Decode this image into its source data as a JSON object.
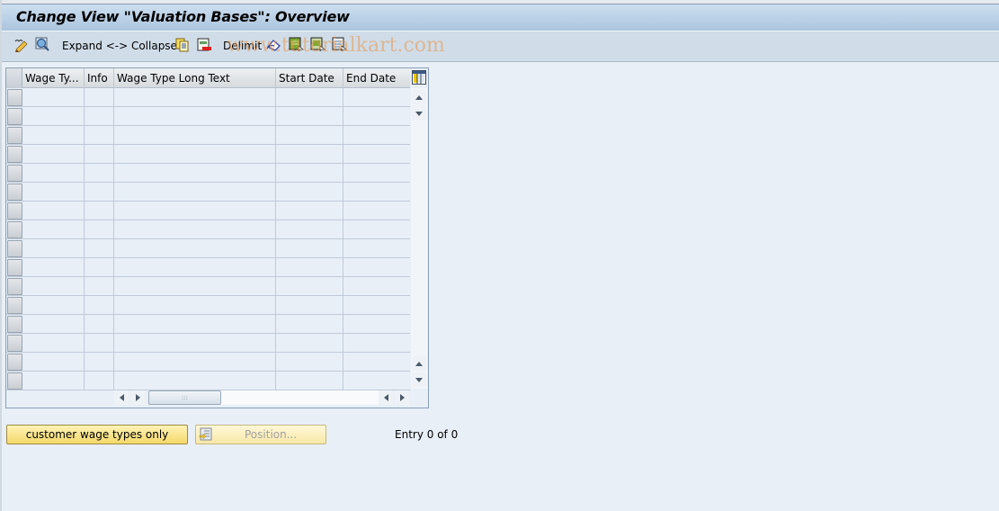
{
  "window": {
    "title": "Change View \"Valuation Bases\": Overview"
  },
  "toolbar": {
    "items": [
      {
        "name": "change-display-icon",
        "label": ""
      },
      {
        "name": "details-icon",
        "label": ""
      },
      {
        "name": "expand-collapse",
        "label": "Expand <-> Collapse"
      },
      {
        "name": "copy-icon",
        "label": ""
      },
      {
        "name": "delete-icon",
        "label": ""
      },
      {
        "name": "delimit",
        "label": "Delimit"
      },
      {
        "name": "undo-icon",
        "label": ""
      },
      {
        "name": "select-all-icon",
        "label": ""
      },
      {
        "name": "select-block-icon",
        "label": ""
      },
      {
        "name": "deselect-all-icon",
        "label": ""
      }
    ],
    "watermark": "www.tutorialkart.com"
  },
  "table": {
    "columns": [
      "Wage Ty...",
      "Info",
      "Wage Type Long Text",
      "Start Date",
      "End Date"
    ],
    "rows": [
      [
        "",
        "",
        "",
        "",
        ""
      ],
      [
        "",
        "",
        "",
        "",
        ""
      ],
      [
        "",
        "",
        "",
        "",
        ""
      ],
      [
        "",
        "",
        "",
        "",
        ""
      ],
      [
        "",
        "",
        "",
        "",
        ""
      ],
      [
        "",
        "",
        "",
        "",
        ""
      ],
      [
        "",
        "",
        "",
        "",
        ""
      ],
      [
        "",
        "",
        "",
        "",
        ""
      ],
      [
        "",
        "",
        "",
        "",
        ""
      ],
      [
        "",
        "",
        "",
        "",
        ""
      ],
      [
        "",
        "",
        "",
        "",
        ""
      ],
      [
        "",
        "",
        "",
        "",
        ""
      ],
      [
        "",
        "",
        "",
        "",
        ""
      ],
      [
        "",
        "",
        "",
        "",
        ""
      ],
      [
        "",
        "",
        "",
        "",
        ""
      ],
      [
        "",
        "",
        "",
        "",
        ""
      ]
    ],
    "hscroll_grip": ":::"
  },
  "footer": {
    "customer_button": "customer wage types only",
    "position_button": "Position...",
    "entry_text": "Entry 0 of 0"
  }
}
